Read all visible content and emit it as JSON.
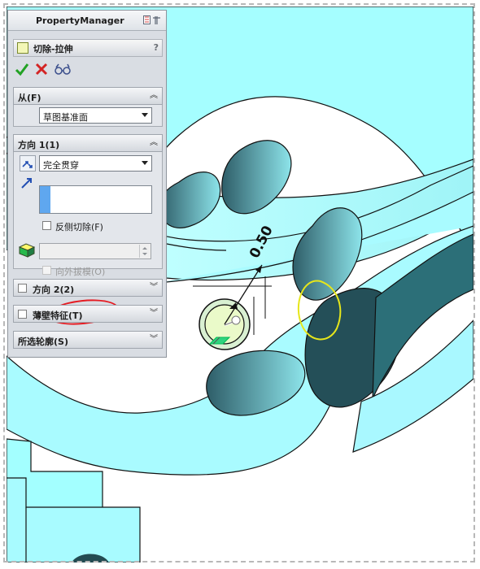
{
  "pm": {
    "title": "PropertyManager",
    "feature_title": "切除-拉伸",
    "help": "?",
    "section_from": {
      "label": "从(F)",
      "value": "草图基准面"
    },
    "section_dir1": {
      "label": "方向 1(1)",
      "value": "完全贯穿",
      "reverse_label": "反侧切除(F)",
      "draft_label": "向外拔模(O)"
    },
    "section_dir2": {
      "label": "方向 2(2)"
    },
    "section_thin": {
      "label": "薄壁特征(T)"
    },
    "section_contours": {
      "label": "所选轮廓(S)"
    }
  },
  "graphics": {
    "dimension": "0.50"
  }
}
